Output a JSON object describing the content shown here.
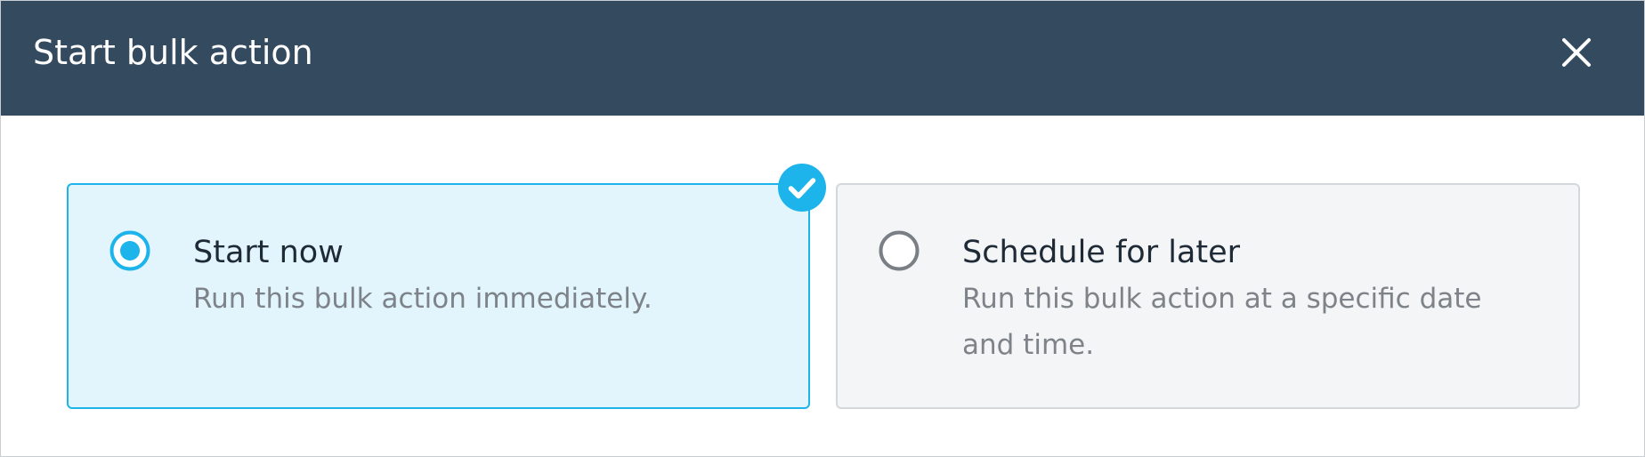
{
  "dialog": {
    "title": "Start bulk action",
    "close_icon": "close-icon"
  },
  "options": [
    {
      "title": "Start now",
      "description": "Run this bulk action immediately.",
      "selected": true
    },
    {
      "title": "Schedule for later",
      "description": "Run this bulk action at a specific date and time.",
      "selected": false
    }
  ],
  "colors": {
    "header_bg": "#344a5f",
    "accent": "#1cb4ea",
    "selected_bg": "#e2f5fd",
    "unselected_bg": "#f4f5f7"
  }
}
